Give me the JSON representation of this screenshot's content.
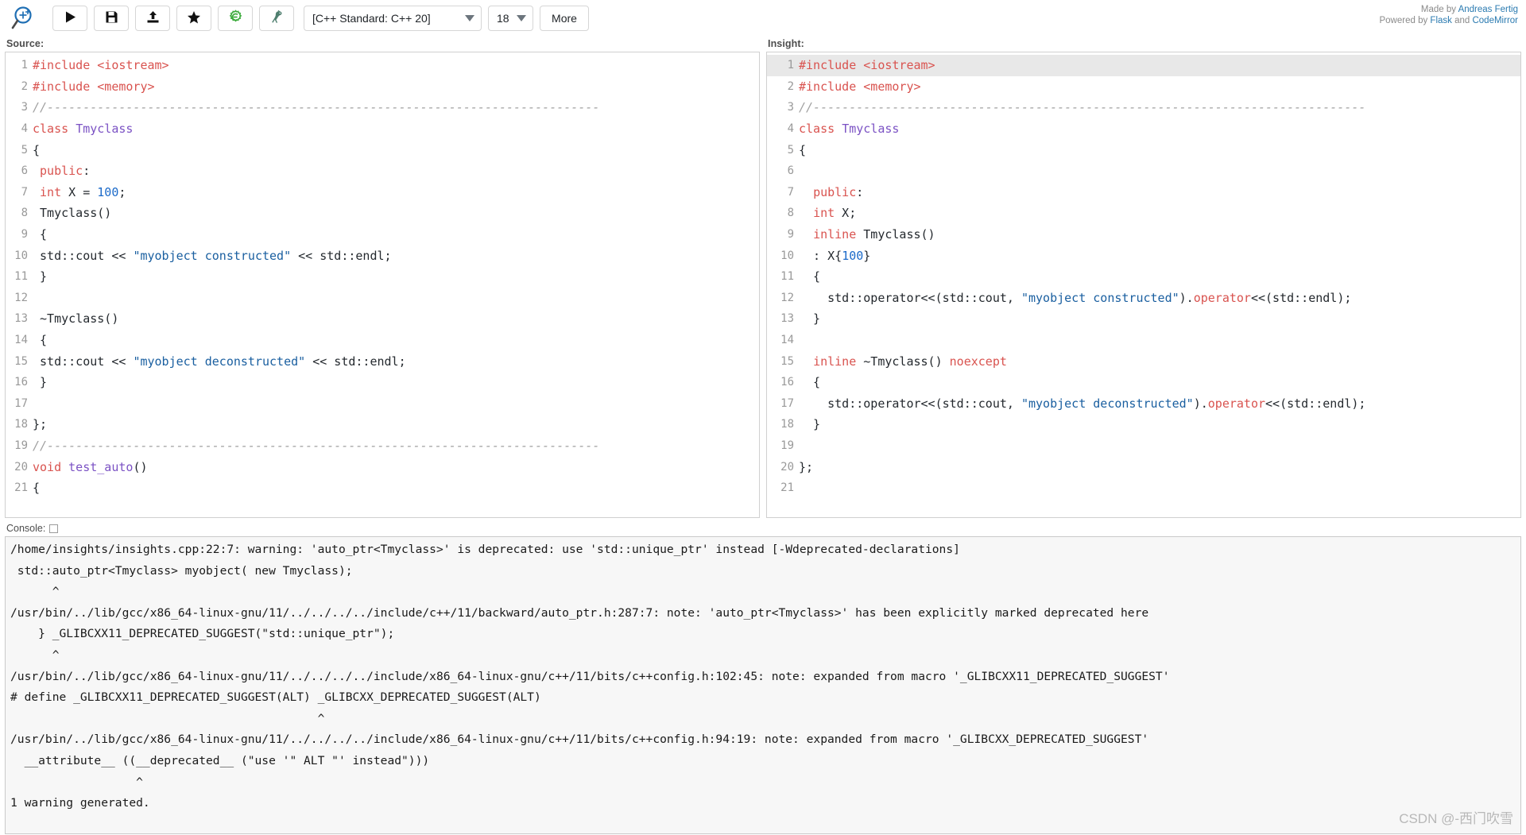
{
  "toolbar": {
    "logo_icon": "magnifier-cpp-icon",
    "buttons": [
      {
        "name": "run-button",
        "icon": "play-icon",
        "label": ""
      },
      {
        "name": "save-button",
        "icon": "floppy-disk-icon",
        "label": ""
      },
      {
        "name": "upload-button",
        "icon": "upload-icon",
        "label": ""
      },
      {
        "name": "favorite-button",
        "icon": "star-icon",
        "label": ""
      },
      {
        "name": "cppinsights-button",
        "icon": "gear-e-icon",
        "label": ""
      },
      {
        "name": "ostrich-button",
        "icon": "ostrich-icon",
        "label": ""
      }
    ],
    "standard_select": {
      "value": "[C++ Standard: C++ 20]"
    },
    "font_select": {
      "value": "18"
    },
    "more_label": "More"
  },
  "credits": {
    "made_by_prefix": "Made by ",
    "made_by_name": "Andreas Fertig",
    "powered_prefix": "Powered by ",
    "powered_a": "Flask",
    "powered_and": " and ",
    "powered_b": "CodeMirror"
  },
  "source": {
    "label": "Source:",
    "lines": [
      {
        "n": "1",
        "html": "<span class='pre'>#include &lt;iostream&gt;</span>"
      },
      {
        "n": "2",
        "html": "<span class='pre'>#include &lt;memory&gt;</span>"
      },
      {
        "n": "3",
        "html": "<span class='cmt'>//-----------------------------------------------------------------------------</span>"
      },
      {
        "n": "4",
        "html": "<span class='kw'>class</span> <span class='typ'>Tmyclass</span>"
      },
      {
        "n": "5",
        "html": "{"
      },
      {
        "n": "6",
        "html": " <span class='kw'>public</span>:"
      },
      {
        "n": "7",
        "html": " <span class='kw'>int</span> X = <span class='num'>100</span>;"
      },
      {
        "n": "8",
        "html": " Tmyclass()"
      },
      {
        "n": "9",
        "html": " {"
      },
      {
        "n": "10",
        "html": " std::cout &lt;&lt; <span class='str'>\"myobject constructed\"</span> &lt;&lt; std::endl;"
      },
      {
        "n": "11",
        "html": " }"
      },
      {
        "n": "12",
        "html": ""
      },
      {
        "n": "13",
        "html": " ~Tmyclass()"
      },
      {
        "n": "14",
        "html": " {"
      },
      {
        "n": "15",
        "html": " std::cout &lt;&lt; <span class='str'>\"myobject deconstructed\"</span> &lt;&lt; std::endl;"
      },
      {
        "n": "16",
        "html": " }"
      },
      {
        "n": "17",
        "html": ""
      },
      {
        "n": "18",
        "html": "};"
      },
      {
        "n": "19",
        "html": "<span class='cmt'>//-----------------------------------------------------------------------------</span>"
      },
      {
        "n": "20",
        "html": "<span class='kw'>void</span> <span class='typ'>test_auto</span>()"
      },
      {
        "n": "21",
        "html": "{"
      }
    ]
  },
  "insight": {
    "label": "Insight:",
    "lines": [
      {
        "n": "1",
        "active": true,
        "html": "<span class='pre'>#include &lt;iostream&gt;</span>"
      },
      {
        "n": "2",
        "active": false,
        "html": "<span class='pre'>#include &lt;memory&gt;</span>"
      },
      {
        "n": "3",
        "active": false,
        "html": "<span class='cmt'>//-----------------------------------------------------------------------------</span>"
      },
      {
        "n": "4",
        "active": false,
        "html": "<span class='kw'>class</span> <span class='typ'>Tmyclass</span>"
      },
      {
        "n": "5",
        "active": false,
        "html": "{"
      },
      {
        "n": "6",
        "active": false,
        "html": ""
      },
      {
        "n": "7",
        "active": false,
        "html": "  <span class='kw'>public</span>:"
      },
      {
        "n": "8",
        "active": false,
        "html": "  <span class='kw'>int</span> X;"
      },
      {
        "n": "9",
        "active": false,
        "html": "  <span class='kw'>inline</span> Tmyclass()"
      },
      {
        "n": "10",
        "active": false,
        "html": "  : X{<span class='num'>100</span>}"
      },
      {
        "n": "11",
        "active": false,
        "html": "  {"
      },
      {
        "n": "12",
        "active": false,
        "html": "    std::operator&lt;&lt;(std::cout, <span class='str'>\"myobject constructed\"</span>).<span class='op'>operator</span>&lt;&lt;(std::endl);"
      },
      {
        "n": "13",
        "active": false,
        "html": "  }"
      },
      {
        "n": "14",
        "active": false,
        "html": ""
      },
      {
        "n": "15",
        "active": false,
        "html": "  <span class='kw'>inline</span> ~Tmyclass() <span class='kw'>noexcept</span>"
      },
      {
        "n": "16",
        "active": false,
        "html": "  {"
      },
      {
        "n": "17",
        "active": false,
        "html": "    std::operator&lt;&lt;(std::cout, <span class='str'>\"myobject deconstructed\"</span>).<span class='op'>operator</span>&lt;&lt;(std::endl);"
      },
      {
        "n": "18",
        "active": false,
        "html": "  }"
      },
      {
        "n": "19",
        "active": false,
        "html": ""
      },
      {
        "n": "20",
        "active": false,
        "html": "};"
      },
      {
        "n": "21",
        "active": false,
        "html": ""
      }
    ]
  },
  "console": {
    "label": "Console:",
    "checkbox_icon": "checkbox-icon",
    "output": [
      "/home/insights/insights.cpp:22:7: warning: 'auto_ptr<Tmyclass>' is deprecated: use 'std::unique_ptr' instead [-Wdeprecated-declarations]",
      " std::auto_ptr<Tmyclass> myobject( new Tmyclass);",
      "      ^",
      "/usr/bin/../lib/gcc/x86_64-linux-gnu/11/../../../../include/c++/11/backward/auto_ptr.h:287:7: note: 'auto_ptr<Tmyclass>' has been explicitly marked deprecated here",
      "    } _GLIBCXX11_DEPRECATED_SUGGEST(\"std::unique_ptr\");",
      "      ^",
      "/usr/bin/../lib/gcc/x86_64-linux-gnu/11/../../../../include/x86_64-linux-gnu/c++/11/bits/c++config.h:102:45: note: expanded from macro '_GLIBCXX11_DEPRECATED_SUGGEST'",
      "# define _GLIBCXX11_DEPRECATED_SUGGEST(ALT) _GLIBCXX_DEPRECATED_SUGGEST(ALT)",
      "                                            ^",
      "/usr/bin/../lib/gcc/x86_64-linux-gnu/11/../../../../include/x86_64-linux-gnu/c++/11/bits/c++config.h:94:19: note: expanded from macro '_GLIBCXX_DEPRECATED_SUGGEST'",
      "  __attribute__ ((__deprecated__ (\"use '\" ALT \"' instead\")))",
      "                  ^",
      "1 warning generated."
    ]
  },
  "watermark": {
    "text": "CSDN @-西门吹雪"
  },
  "colors": {
    "keyword": "#d9534f",
    "type": "#7b52c4",
    "string": "#1a5fa0",
    "number": "#1b6ac9",
    "comment": "#a0a0a0",
    "link": "#2a7ab0",
    "active_line": "#e8e8e8"
  }
}
